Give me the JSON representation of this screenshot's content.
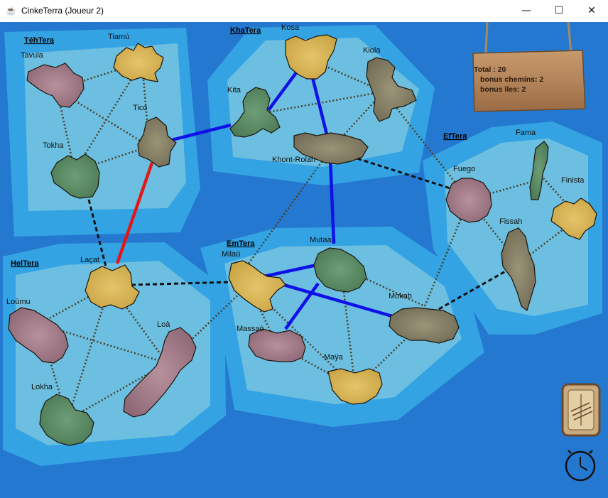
{
  "window": {
    "title": "CinkeTerra (Joueur 2)",
    "app_icon": "java-cup-icon",
    "minimize_glyph": "—",
    "maximize_glyph": "☐",
    "close_glyph": "✕"
  },
  "colors": {
    "ocean": "#2478cf",
    "region_ring": "#33a3e3",
    "region_inner": "#6cbfe0",
    "dotted_link": "#4a3f2a",
    "player_blue": "#1010e8",
    "player_red": "#e01818",
    "dashed_link": "#111111"
  },
  "regions": {
    "tehtera": "TéhTera",
    "khatera": "KhaTera",
    "eftera": "EfTera",
    "heltera": "HelTera",
    "emtera": "EmTera"
  },
  "islands": {
    "tavula": "Tavula",
    "tiamu": "Tiamù",
    "tico": "Ticó",
    "tokha": "Tokha",
    "kosa": "Kosa",
    "kiola": "Kiola",
    "kita": "Kita",
    "khont": "Khont-Rolah",
    "fama": "Fama",
    "fuego": "Fuego",
    "finista": "Finista",
    "fissah": "Fissah",
    "lacat": "Laçat",
    "loumu": "Loùmu",
    "loa": "Loà",
    "lokha": "Lokha",
    "milau": "Milaù",
    "mutaa": "Mutaa",
    "mokah": "Mokah",
    "massao": "Massaò",
    "maya": "Maÿa"
  },
  "score_sign": {
    "total": "Total : 20",
    "bonus_paths": "bonus chemins: 2",
    "bonus_islands": "bonus îles: 2"
  },
  "icons": {
    "action_button": "bridge-card-icon",
    "timer": "stopwatch-icon"
  }
}
